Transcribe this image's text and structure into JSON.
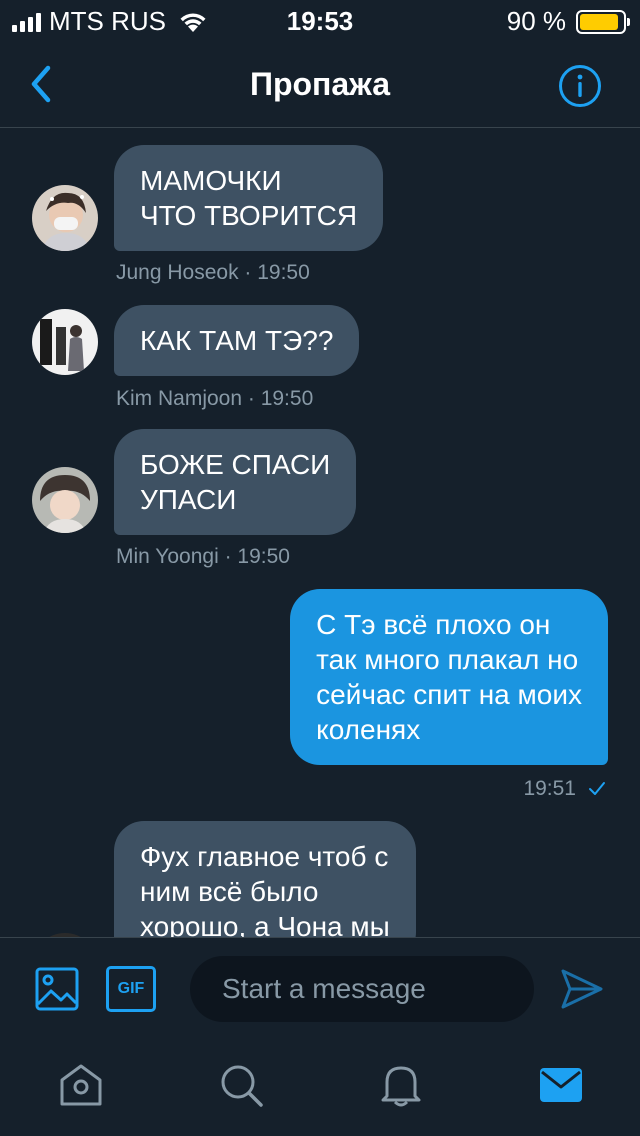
{
  "status_bar": {
    "carrier": "MTS RUS",
    "time": "19:53",
    "battery_text": "90 %",
    "battery_level": 0.9
  },
  "header": {
    "title": "Пропажа",
    "back_icon": "chevron-left-icon",
    "info_icon": "info-icon"
  },
  "messages": [
    {
      "direction": "in",
      "text": "МАМОЧКИ\nЧТО ТВОРИТСЯ",
      "author": "Jung Hoseok",
      "time": "19:50",
      "meta": "Jung Hoseok · 19:50"
    },
    {
      "direction": "in",
      "text": "КАК ТАМ ТЭ??",
      "author": "Kim Namjoon",
      "time": "19:50",
      "meta": "Kim Namjoon · 19:50"
    },
    {
      "direction": "in",
      "text": "БОЖЕ СПАСИ\nУПАСИ",
      "author": "Min Yoongi",
      "time": "19:50",
      "meta": "Min Yoongi · 19:50"
    },
    {
      "direction": "out",
      "text": "С Тэ всё плохо он\nтак много плакал но\nсейчас спит на моих\nколенях",
      "time": "19:51",
      "read": true
    },
    {
      "direction": "in",
      "text": "Фух главное чтоб с\nним всё было\nхорошо, а Чона мы"
    }
  ],
  "compose": {
    "placeholder": "Start a message",
    "gif_label": "GIF",
    "image_icon": "image-icon",
    "send_icon": "send-icon"
  },
  "tabbar": {
    "items": [
      "home-icon",
      "search-icon",
      "notifications-icon",
      "messages-icon"
    ],
    "active": "messages-icon"
  },
  "colors": {
    "background": "#15202b",
    "accent": "#1da1f2",
    "incoming_bubble": "#3e5163",
    "outgoing_bubble": "#1b95e0",
    "meta_text": "#8899a6",
    "battery": "#ffcc00"
  }
}
